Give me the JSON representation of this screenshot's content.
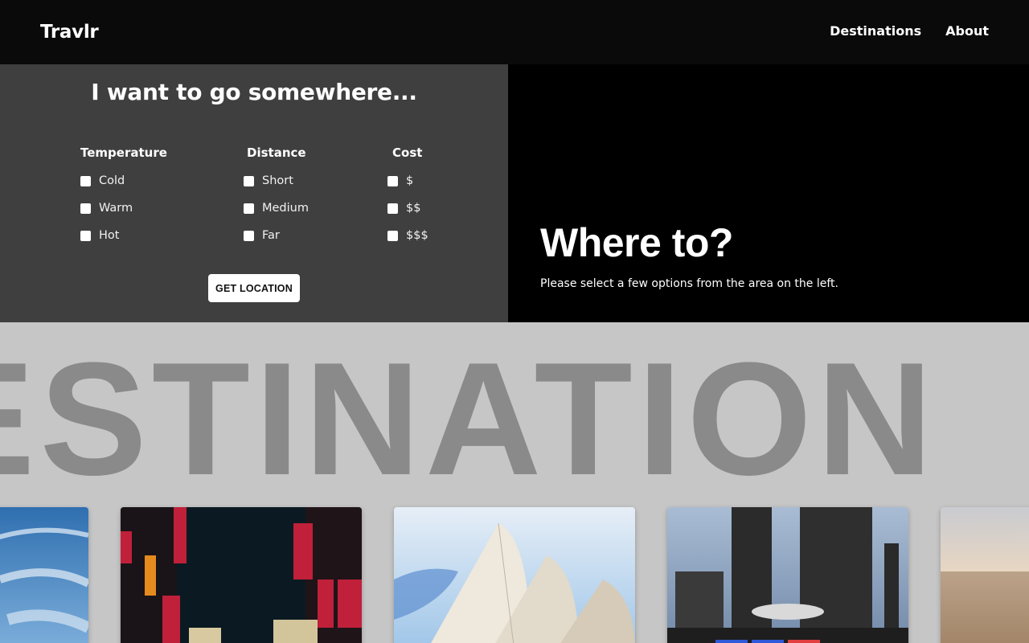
{
  "header": {
    "logo": "Travlr",
    "nav": [
      {
        "label": "Destinations"
      },
      {
        "label": "About"
      }
    ]
  },
  "search": {
    "title": "I want to go somewhere...",
    "columns": [
      {
        "heading": "Temperature",
        "options": [
          "Cold",
          "Warm",
          "Hot"
        ]
      },
      {
        "heading": "Distance",
        "options": [
          "Short",
          "Medium",
          "Far"
        ]
      },
      {
        "heading": "Cost",
        "options": [
          "$",
          "$$",
          "$$$"
        ]
      }
    ],
    "button_label": "GET LOCATION"
  },
  "result": {
    "title": "Where to?",
    "subtitle": "Please select a few options from the area on the left."
  },
  "destinations": {
    "heading": "ESTINATION",
    "cards": [
      {
        "name": "sky-card",
        "colors": [
          "#2f6fb0",
          "#7fb0dc"
        ]
      },
      {
        "name": "tokyo-street-card",
        "colors": [
          "#0b1a22",
          "#c0203a"
        ]
      },
      {
        "name": "sydney-opera-card",
        "colors": [
          "#9ec5e8",
          "#efe8dc"
        ]
      },
      {
        "name": "toronto-city-hall-card",
        "colors": [
          "#7d97b8",
          "#2b2b2b"
        ]
      },
      {
        "name": "city-aerial-card",
        "colors": [
          "#c9cbd0",
          "#a9886a"
        ]
      }
    ]
  }
}
